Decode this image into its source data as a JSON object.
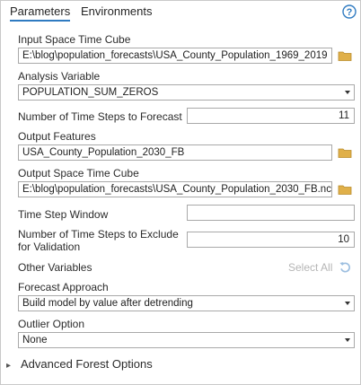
{
  "tabs": [
    {
      "label": "Parameters",
      "active": true
    },
    {
      "label": "Environments",
      "active": false
    }
  ],
  "help_icon": "question-circle-icon",
  "params": {
    "input_cube": {
      "label": "Input Space Time Cube",
      "value": "E:\\blog\\population_forecasts\\USA_County_Population_1969_2019"
    },
    "analysis_variable": {
      "label": "Analysis Variable",
      "value": "POPULATION_SUM_ZEROS"
    },
    "time_steps_forecast": {
      "label": "Number of Time Steps to Forecast",
      "value": "11"
    },
    "output_features": {
      "label": "Output Features",
      "value": "USA_County_Population_2030_FB"
    },
    "output_cube": {
      "label": "Output Space Time Cube",
      "value": "E:\\blog\\population_forecasts\\USA_County_Population_2030_FB.nc"
    },
    "time_step_window": {
      "label": "Time Step Window",
      "value": ""
    },
    "exclude_validation": {
      "label_line1": "Number of Time Steps to Exclude",
      "label_line2": "for Validation",
      "value": "10"
    },
    "other_variables": {
      "label": "Other Variables",
      "select_all": "Select All"
    },
    "forecast_approach": {
      "label": "Forecast Approach",
      "value": "Build model by value after detrending"
    },
    "outlier_option": {
      "label": "Outlier Option",
      "value": "None"
    }
  },
  "advanced": {
    "label": "Advanced Forest Options",
    "expanded": false
  },
  "colors": {
    "accent": "#2f7bc1",
    "folder": "#e0b04a",
    "disabled": "#b5b5b5"
  }
}
